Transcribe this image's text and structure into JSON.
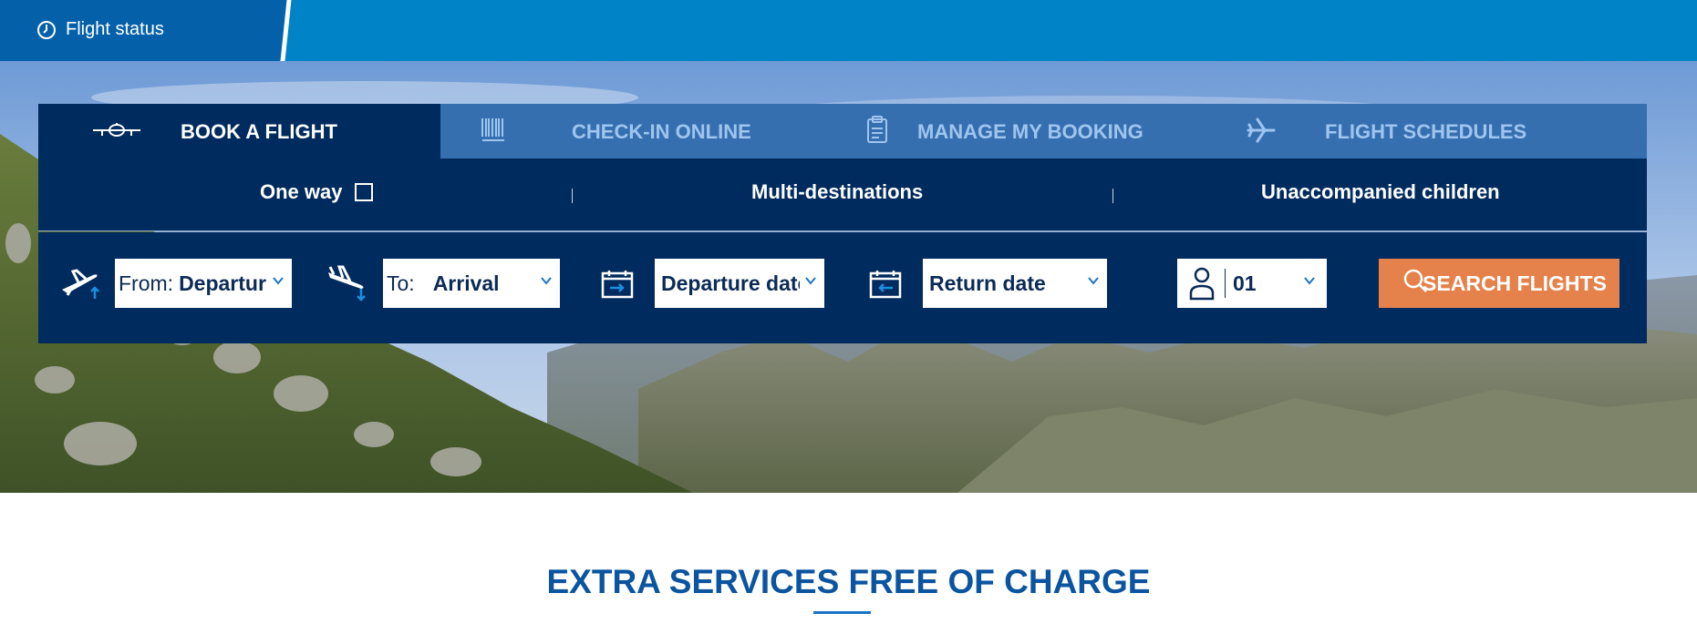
{
  "topbar": {
    "flight_status_label": "Flight status",
    "background_color": "#0084c7",
    "tab_color": "#0461a9"
  },
  "tabs": [
    {
      "label": "BOOK A FLIGHT",
      "icon": "plane-front-icon",
      "active": true
    },
    {
      "label": "CHECK-IN ONLINE",
      "icon": "barcode-icon",
      "active": false
    },
    {
      "label": "MANAGE MY BOOKING",
      "icon": "clipboard-icon",
      "active": false
    },
    {
      "label": "FLIGHT SCHEDULES",
      "icon": "airplane-icon",
      "active": false
    }
  ],
  "options": {
    "one_way": "One way",
    "multi_destinations": "Multi-destinations",
    "unaccompanied_children": "Unaccompanied children"
  },
  "form": {
    "from_label": "From:",
    "from_value": "Departur",
    "to_label": "To:",
    "to_value": "Arrival",
    "departure_date": "Departure date",
    "return_date": "Return date",
    "passengers": "01",
    "search_label": "SEARCH FLIGHTS"
  },
  "extra": {
    "title": "EXTRA SERVICES FREE OF CHARGE"
  },
  "colors": {
    "widget_dark": "#002b5e",
    "tab_inactive": "#366fb0",
    "tab_inactive_text": "#9fc5ee",
    "search_button": "#e5814a",
    "heading": "#0a54a0"
  }
}
